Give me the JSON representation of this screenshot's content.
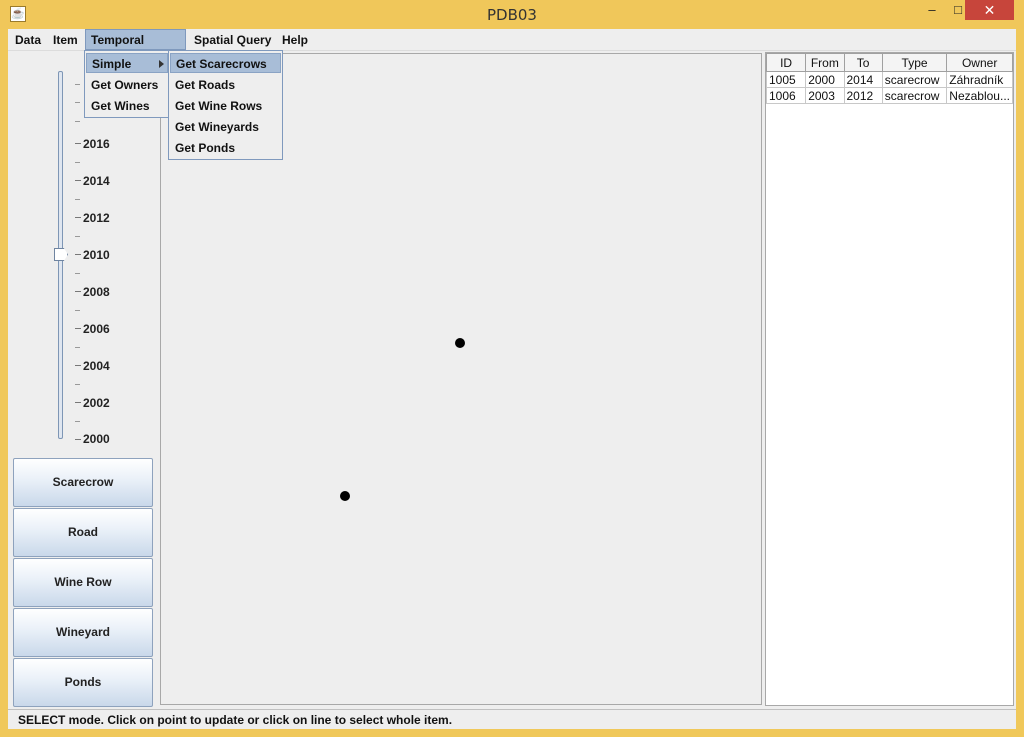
{
  "window": {
    "title": "PDB03",
    "controls": {
      "minimize": "–",
      "maximize": "□",
      "close": "✕"
    }
  },
  "menubar": {
    "items": [
      "Data",
      "Item",
      "Temporal Query",
      "Spatial Query",
      "Help"
    ],
    "active": "Temporal Query"
  },
  "temporal_menu": {
    "items": [
      "Simple",
      "Get Owners",
      "Get Wines"
    ],
    "highlighted": "Simple"
  },
  "simple_submenu": {
    "items": [
      "Get Scarecrows",
      "Get Roads",
      "Get Wine Rows",
      "Get Wineyards",
      "Get Ponds"
    ],
    "highlighted": "Get Scarecrows"
  },
  "slider": {
    "labels": [
      "2016",
      "2014",
      "2012",
      "2010",
      "2008",
      "2006",
      "2004",
      "2002",
      "2000"
    ],
    "min": 2000,
    "max": 2016,
    "value": 2010
  },
  "tool_buttons": [
    "Scarecrow",
    "Road",
    "Wine Row",
    "Wineyard",
    "Ponds"
  ],
  "table": {
    "columns": [
      "ID",
      "From",
      "To",
      "Type",
      "Owner"
    ],
    "rows": [
      [
        "1005",
        "2000",
        "2014",
        "scarecrow",
        "Záhradník"
      ],
      [
        "1006",
        "2003",
        "2012",
        "scarecrow",
        "Nezablou..."
      ]
    ]
  },
  "status": {
    "text": "SELECT mode. Click on point to update or click on line to select whole item."
  },
  "colors": {
    "titlebar": "#f0c75a",
    "close_button": "#c7453b",
    "menu_highlight": "#a8bdd7",
    "window_background": "#eeeeee"
  }
}
